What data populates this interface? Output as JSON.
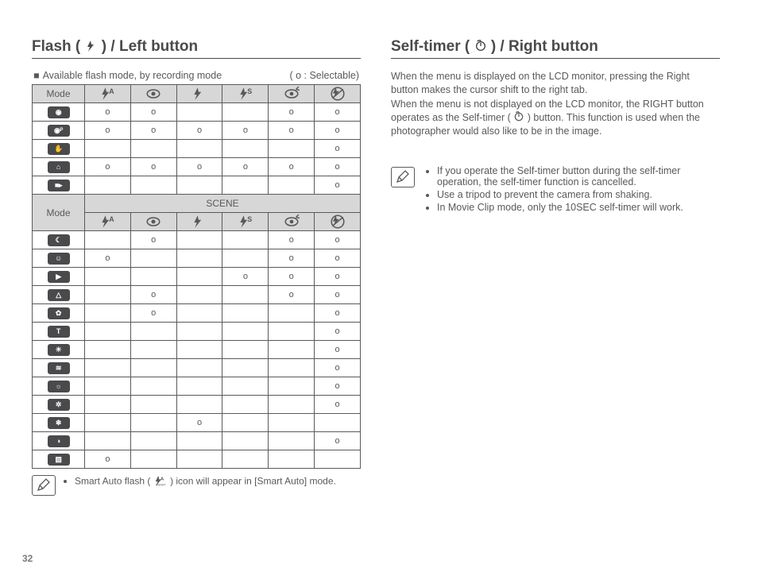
{
  "page_number": "32",
  "left": {
    "heading_pre": "Flash (",
    "heading_post": ") / Left button",
    "caption_left": "Available flash mode, by recording mode",
    "caption_right": "( o : Selectable)",
    "mode_label": "Mode",
    "scene_label": "SCENE",
    "mark": "o",
    "col_icons": [
      "flash-auto",
      "redeye",
      "flash-fill",
      "flash-slow",
      "redeye-fix",
      "flash-off"
    ],
    "top_rows": [
      {
        "mode_icon": "camera",
        "cells": [
          "o",
          "o",
          "",
          "",
          "o",
          "o"
        ]
      },
      {
        "mode_icon": "camera-p",
        "cells": [
          "o",
          "o",
          "o",
          "o",
          "o",
          "o"
        ]
      },
      {
        "mode_icon": "dual-is",
        "cells": [
          "",
          "",
          "",
          "",
          "",
          "o"
        ]
      },
      {
        "mode_icon": "program",
        "cells": [
          "o",
          "o",
          "o",
          "o",
          "o",
          "o"
        ]
      },
      {
        "mode_icon": "movie",
        "cells": [
          "",
          "",
          "",
          "",
          "",
          "o"
        ]
      }
    ],
    "scene_rows": [
      {
        "mode_icon": "night",
        "cells": [
          "",
          "o",
          "",
          "",
          "o",
          "o"
        ]
      },
      {
        "mode_icon": "portrait",
        "cells": [
          "o",
          "",
          "",
          "",
          "o",
          "o"
        ]
      },
      {
        "mode_icon": "children",
        "cells": [
          "",
          "",
          "",
          "o",
          "o",
          "o"
        ]
      },
      {
        "mode_icon": "landscape",
        "cells": [
          "",
          "o",
          "",
          "",
          "o",
          "o"
        ]
      },
      {
        "mode_icon": "closeup",
        "cells": [
          "",
          "o",
          "",
          "",
          "",
          "o"
        ]
      },
      {
        "mode_icon": "text",
        "cells": [
          "",
          "",
          "",
          "",
          "",
          "o"
        ]
      },
      {
        "mode_icon": "sunset",
        "cells": [
          "",
          "",
          "",
          "",
          "",
          "o"
        ]
      },
      {
        "mode_icon": "dawn",
        "cells": [
          "",
          "",
          "",
          "",
          "",
          "o"
        ]
      },
      {
        "mode_icon": "backlight",
        "cells": [
          "",
          "",
          "",
          "",
          "",
          "o"
        ]
      },
      {
        "mode_icon": "firework",
        "cells": [
          "",
          "",
          "",
          "",
          "",
          "o"
        ]
      },
      {
        "mode_icon": "beach-snow",
        "cells": [
          "",
          "",
          "o",
          "",
          "",
          ""
        ]
      },
      {
        "mode_icon": "self-shot",
        "cells": [
          "",
          "",
          "",
          "",
          "",
          "o"
        ]
      },
      {
        "mode_icon": "food",
        "cells": [
          "o",
          "",
          "",
          "",
          "",
          ""
        ]
      }
    ],
    "note_pre": "Smart Auto flash (",
    "note_post": ") icon will appear in [Smart Auto] mode."
  },
  "right": {
    "heading_pre": "Self-timer (",
    "heading_post": ") / Right button",
    "body": "When the menu is displayed on the LCD monitor, pressing the Right button makes the cursor shift to the right tab.\nWhen the menu is not displayed on the LCD monitor, the RIGHT button operates as the Self-timer (      ) button. This function is used when the photographer would also like to be in the image.",
    "body_l1": "When the menu is displayed on the LCD monitor, pressing the Right button makes the cursor shift to the right tab.",
    "body_l2a": "When the menu is not displayed on the LCD monitor, the RIGHT button operates as the Self-timer (",
    "body_l2b": ") button. This function is used when the photographer would also like to be in the image.",
    "notes": [
      "If you operate the Self-timer button during the self-timer operation, the self-timer function is cancelled.",
      "Use a tripod to prevent the camera from shaking.",
      "In Movie Clip mode, only the 10SEC self-timer will work."
    ]
  }
}
